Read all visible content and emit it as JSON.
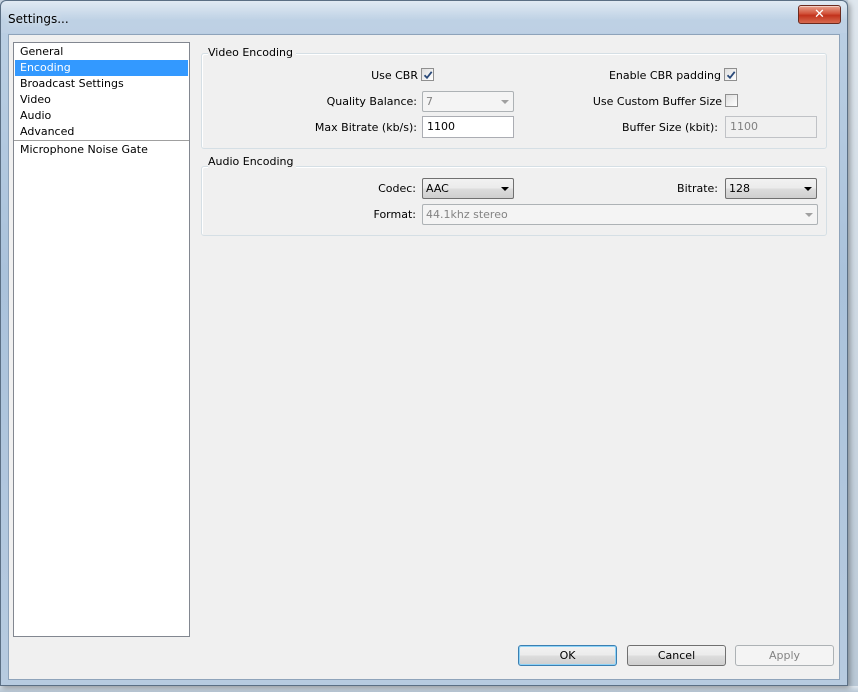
{
  "window": {
    "title": "Settings...",
    "close_glyph": "✕"
  },
  "nav": {
    "items": [
      {
        "label": "General",
        "selected": false
      },
      {
        "label": "Encoding",
        "selected": true
      },
      {
        "label": "Broadcast Settings",
        "selected": false
      },
      {
        "label": "Video",
        "selected": false
      },
      {
        "label": "Audio",
        "selected": false
      },
      {
        "label": "Advanced",
        "selected": false
      }
    ],
    "plugins": [
      {
        "label": "Microphone Noise Gate"
      }
    ]
  },
  "video_encoding": {
    "title": "Video Encoding",
    "use_cbr": {
      "label": "Use CBR",
      "checked": true
    },
    "quality_balance": {
      "label": "Quality Balance:",
      "value": "7"
    },
    "max_bitrate": {
      "label": "Max Bitrate (kb/s):",
      "value": "1100"
    },
    "enable_cbr_padding": {
      "label": "Enable CBR padding",
      "checked": true
    },
    "use_custom_buffer": {
      "label": "Use Custom Buffer Size",
      "checked": false
    },
    "buffer_size": {
      "label": "Buffer Size (kbit):",
      "value": "1100"
    }
  },
  "audio_encoding": {
    "title": "Audio Encoding",
    "codec": {
      "label": "Codec:",
      "value": "AAC"
    },
    "bitrate": {
      "label": "Bitrate:",
      "value": "128"
    },
    "format": {
      "label": "Format:",
      "value": "44.1khz stereo"
    }
  },
  "buttons": {
    "ok": "OK",
    "cancel": "Cancel",
    "apply": "Apply"
  },
  "colors": {
    "selection": "#3399ff",
    "dialog_bg": "#f0f0f0",
    "close_red": "#c2321c"
  }
}
